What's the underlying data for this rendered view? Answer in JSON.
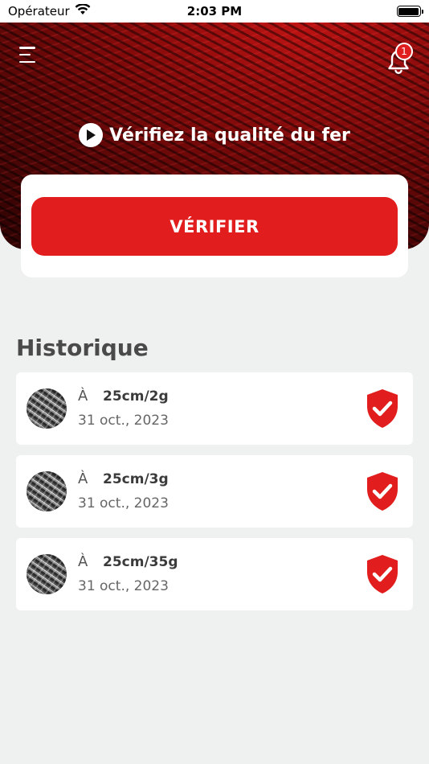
{
  "status_bar": {
    "carrier": "Opérateur",
    "time": "2:03 PM",
    "wifi_icon": "wifi-icon",
    "battery_icon": "battery-icon"
  },
  "header": {
    "menu_icon": "hamburger-menu-icon",
    "notification_icon": "bell-icon",
    "notification_count": "1",
    "title": "Vérifiez la qualité du fer",
    "title_icon": "play-circle-icon"
  },
  "verify": {
    "button_label": "VÉRIFIER"
  },
  "history": {
    "title": "Historique",
    "items": [
      {
        "prefix": "À",
        "value": "25cm/2g",
        "date": "31 oct., 2023",
        "status_icon": "shield-check-icon"
      },
      {
        "prefix": "À",
        "value": "25cm/3g",
        "date": "31 oct., 2023",
        "status_icon": "shield-check-icon"
      },
      {
        "prefix": "À",
        "value": "25cm/35g",
        "date": "31 oct., 2023",
        "status_icon": "shield-check-icon"
      }
    ]
  },
  "colors": {
    "accent": "#e11d1d",
    "background": "#eff0f0",
    "card": "#ffffff"
  }
}
